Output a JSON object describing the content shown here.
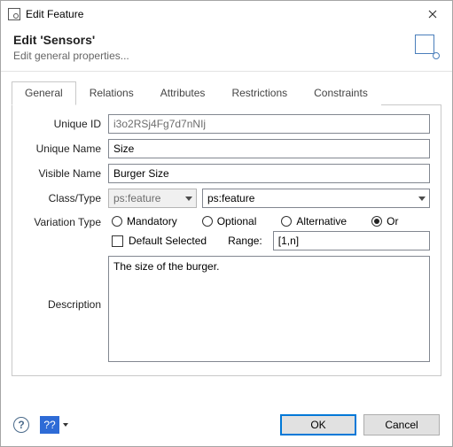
{
  "window": {
    "title": "Edit Feature"
  },
  "header": {
    "title": "Edit 'Sensors'",
    "subtitle": "Edit general properties..."
  },
  "tabs": {
    "general": "General",
    "relations": "Relations",
    "attributes": "Attributes",
    "restrictions": "Restrictions",
    "constraints": "Constraints"
  },
  "labels": {
    "unique_id": "Unique ID",
    "unique_name": "Unique Name",
    "visible_name": "Visible Name",
    "class_type": "Class/Type",
    "variation_type": "Variation Type",
    "description": "Description",
    "range": "Range:"
  },
  "fields": {
    "unique_id": "i3o2RSj4Fg7d7nNIj",
    "unique_name": "Size",
    "visible_name": "Burger Size",
    "class_fixed": "ps:feature",
    "class_select": "ps:feature",
    "range": "[1,n]",
    "description": "The size of the burger."
  },
  "variation": {
    "mandatory": "Mandatory",
    "optional": "Optional",
    "alternative": "Alternative",
    "or": "Or",
    "default_selected": "Default Selected",
    "selected": "or"
  },
  "buttons": {
    "ok": "OK",
    "cancel": "Cancel",
    "help_extra": "??"
  }
}
